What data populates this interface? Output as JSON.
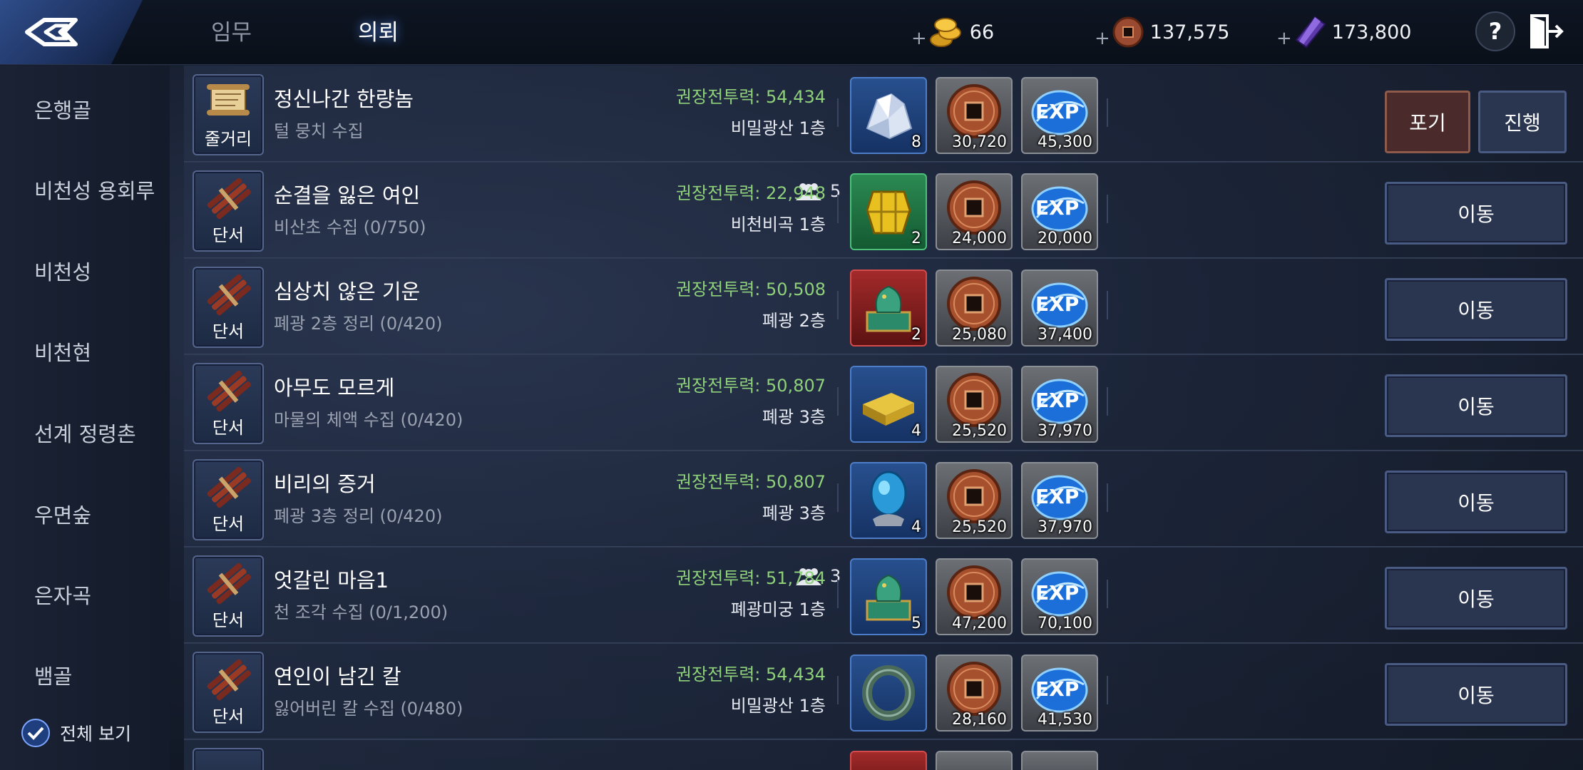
{
  "tabs": {
    "mission": "임무",
    "request": "의뢰"
  },
  "currencies": {
    "gold": "66",
    "coin": "137,575",
    "crystal": "173,800"
  },
  "buttons": {
    "help": "?"
  },
  "sidebar": {
    "items": [
      "은행골",
      "비천성 용회루",
      "비천성",
      "비천현",
      "선계 정령촌",
      "우면숲",
      "은자곡",
      "뱀골"
    ],
    "view_all": "전체 보기"
  },
  "quests": [
    {
      "icon": "scroll-icon",
      "type": "줄거리",
      "title": "정신나간 한량놈",
      "subtitle": "털 뭉치 수집",
      "party": "",
      "power": "권장전투력: 54,434",
      "location": "비밀광산 1층",
      "item": {
        "icon": "crystal-ore-icon",
        "color": "blue",
        "count": "8"
      },
      "coin": "30,720",
      "exp": "45,300",
      "actions": [
        "포기",
        "진행"
      ]
    },
    {
      "icon": "bamboo-scroll-icon",
      "type": "단서",
      "title": "순결을 잃은 여인",
      "subtitle": "비산초 수집 (0/750)",
      "party": "5",
      "power": "권장전투력: 22,948",
      "location": "비천비곡 1층",
      "item": {
        "icon": "gold-armor-icon",
        "color": "green",
        "count": "2"
      },
      "coin": "24,000",
      "exp": "20,000",
      "actions": [
        "이동"
      ]
    },
    {
      "icon": "bamboo-scroll-icon",
      "type": "단서",
      "title": "심상치 않은 기운",
      "subtitle": "폐광 2층 정리 (0/420)",
      "party": "",
      "power": "권장전투력: 50,508",
      "location": "폐광 2층",
      "item": {
        "icon": "jade-seal-icon",
        "color": "red",
        "count": "2"
      },
      "coin": "25,080",
      "exp": "37,400",
      "actions": [
        "이동"
      ]
    },
    {
      "icon": "bamboo-scroll-icon",
      "type": "단서",
      "title": "아무도 모르게",
      "subtitle": "마물의 체액 수집 (0/420)",
      "party": "",
      "power": "권장전투력: 50,807",
      "location": "폐광 3층",
      "item": {
        "icon": "gold-ingot-icon",
        "color": "blue",
        "count": "4"
      },
      "coin": "25,520",
      "exp": "37,970",
      "actions": [
        "이동"
      ]
    },
    {
      "icon": "bamboo-scroll-icon",
      "type": "단서",
      "title": "비리의 증거",
      "subtitle": "폐광 3층 정리 (0/420)",
      "party": "",
      "power": "권장전투력: 50,807",
      "location": "폐광 3층",
      "item": {
        "icon": "blue-orb-icon",
        "color": "blue",
        "count": "4"
      },
      "coin": "25,520",
      "exp": "37,970",
      "actions": [
        "이동"
      ]
    },
    {
      "icon": "bamboo-scroll-icon",
      "type": "단서",
      "title": "엇갈린 마음1",
      "subtitle": "천 조각 수집 (0/1,200)",
      "party": "3",
      "power": "권장전투력: 51,784",
      "location": "폐광미궁 1층",
      "item": {
        "icon": "jade-seal-icon",
        "color": "blue",
        "count": "5"
      },
      "coin": "47,200",
      "exp": "70,100",
      "actions": [
        "이동"
      ]
    },
    {
      "icon": "bamboo-scroll-icon",
      "type": "단서",
      "title": "연인이 남긴 칼",
      "subtitle": "잃어버린 칼 수집 (0/480)",
      "party": "",
      "power": "권장전투력: 54,434",
      "location": "비밀광산 1층",
      "item": {
        "icon": "jade-ring-icon",
        "color": "blue",
        "count": ""
      },
      "coin": "28,160",
      "exp": "41,530",
      "actions": [
        "이동"
      ]
    }
  ],
  "colors": {
    "power_text": "#8fd17a",
    "accent_blue": "#4f8cff",
    "abandon_button": "#4a2a2a",
    "rarity_blue": "#28508e",
    "rarity_green": "#2b8a52",
    "rarity_red": "#a32a2a"
  }
}
